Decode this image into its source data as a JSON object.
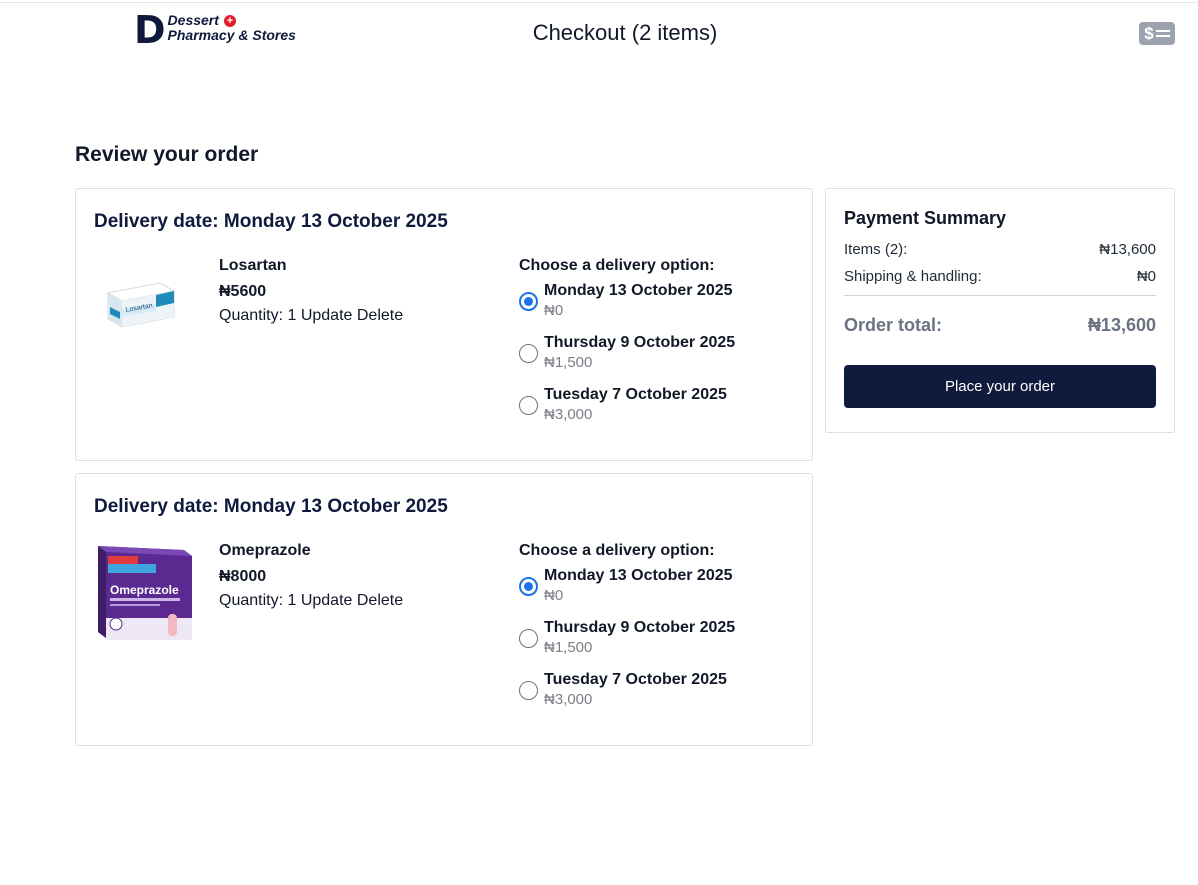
{
  "header": {
    "logo_letter": "D",
    "logo_line1": "Dessert",
    "logo_line2": "Pharmacy & Stores",
    "title": "Checkout (2 items)",
    "icon": "dollar-menu-icon"
  },
  "page_heading": "Review your order",
  "orders": [
    {
      "delivery_date": "Delivery date: Monday 13 October 2025",
      "product": {
        "name": "Losartan",
        "price": "₦5600",
        "quantity_label": "Quantity: 1",
        "update": "Update",
        "delete": "Delete",
        "image_icon": "losartan-box-image"
      },
      "options_title": "Choose a delivery option:",
      "options": [
        {
          "date": "Monday 13 October 2025",
          "price": "₦0",
          "selected": true
        },
        {
          "date": "Thursday 9 October 2025",
          "price": "₦1,500",
          "selected": false
        },
        {
          "date": "Tuesday 7 October 2025",
          "price": "₦3,000",
          "selected": false
        }
      ]
    },
    {
      "delivery_date": "Delivery date: Monday 13 October 2025",
      "product": {
        "name": "Omeprazole",
        "price": "₦8000",
        "quantity_label": "Quantity: 1",
        "update": "Update",
        "delete": "Delete",
        "image_icon": "omeprazole-box-image"
      },
      "options_title": "Choose a delivery option:",
      "options": [
        {
          "date": "Monday 13 October 2025",
          "price": "₦0",
          "selected": true
        },
        {
          "date": "Thursday 9 October 2025",
          "price": "₦1,500",
          "selected": false
        },
        {
          "date": "Tuesday 7 October 2025",
          "price": "₦3,000",
          "selected": false
        }
      ]
    }
  ],
  "summary": {
    "title": "Payment Summary",
    "items_label": "Items (2):",
    "items_value": "₦13,600",
    "shipping_label": "Shipping & handling:",
    "shipping_value": "₦0",
    "total_label": "Order total:",
    "total_value": "₦13,600",
    "button": "Place your order"
  },
  "colors": {
    "brand_navy": "#0f1a3d",
    "accent_blue": "#1a73e8",
    "logo_red": "#e11d2a"
  }
}
